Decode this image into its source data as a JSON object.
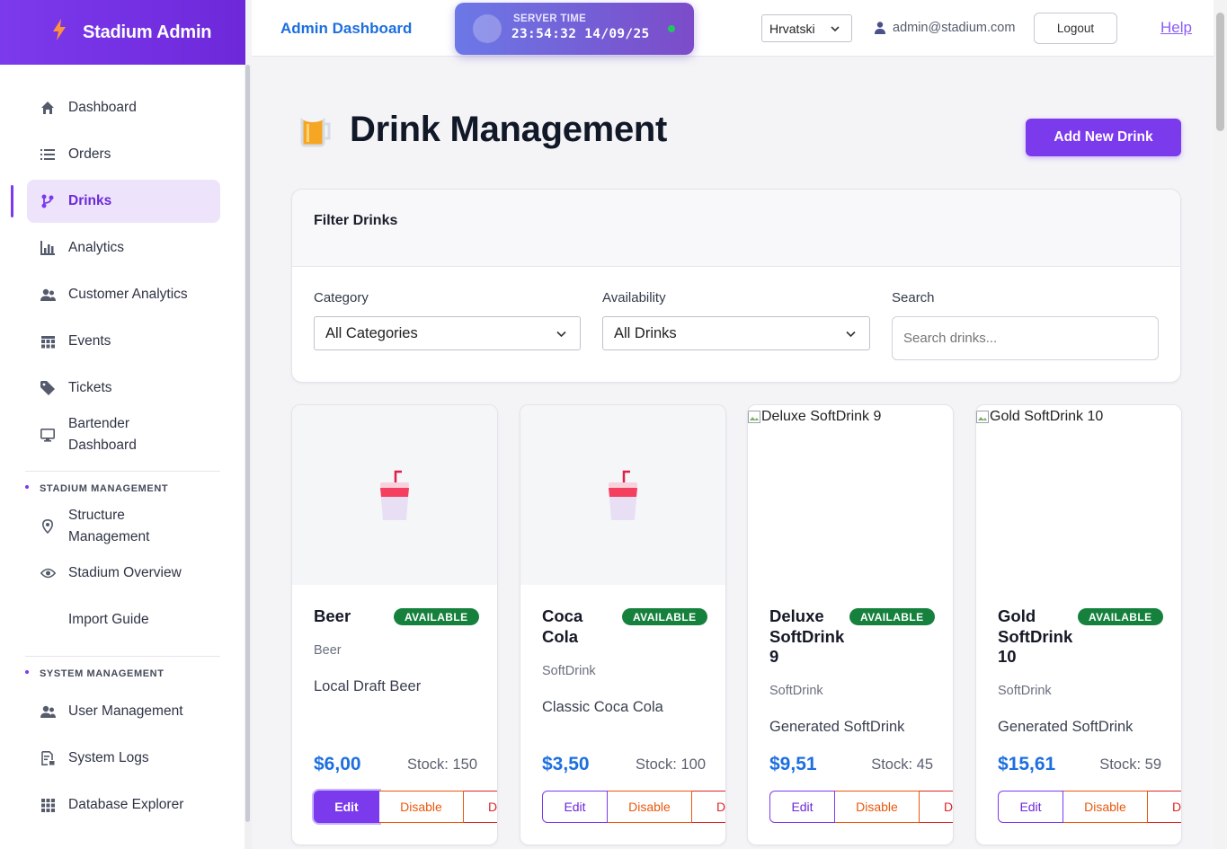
{
  "sidebar": {
    "brand": "Stadium Admin",
    "items": [
      {
        "label": "Dashboard",
        "icon": "home-icon"
      },
      {
        "label": "Orders",
        "icon": "list-icon"
      },
      {
        "label": "Drinks",
        "icon": "drinks-icon",
        "active": true
      },
      {
        "label": "Analytics",
        "icon": "bar-chart-icon"
      },
      {
        "label": "Customer Analytics",
        "icon": "users-icon"
      },
      {
        "label": "Events",
        "icon": "calendar-icon"
      },
      {
        "label": "Tickets",
        "icon": "tag-icon"
      },
      {
        "label": "Bartender Dashboard",
        "icon": "monitor-icon"
      }
    ],
    "stadium_section": "STADIUM MANAGEMENT",
    "stadium_items": [
      {
        "label": "Structure Management",
        "icon": "map-pin-icon"
      },
      {
        "label": "Stadium Overview",
        "icon": "eye-icon"
      },
      {
        "label": "Import Guide",
        "icon": ""
      }
    ],
    "system_section": "SYSTEM MANAGEMENT",
    "system_items": [
      {
        "label": "User Management",
        "icon": "users-icon"
      },
      {
        "label": "System Logs",
        "icon": "logs-icon"
      },
      {
        "label": "Database Explorer",
        "icon": "grid-icon"
      }
    ]
  },
  "header": {
    "title": "Admin Dashboard",
    "server_time_label": "SERVER TIME",
    "server_time_value": "23:54:32 14/09/25",
    "language": "Hrvatski",
    "user_email": "admin@stadium.com",
    "logout": "Logout",
    "help": "Help"
  },
  "page": {
    "title": "Drink Management",
    "add_button": "Add New Drink"
  },
  "filters": {
    "title": "Filter Drinks",
    "category_label": "Category",
    "category_value": "All Categories",
    "availability_label": "Availability",
    "availability_value": "All Drinks",
    "search_label": "Search",
    "search_placeholder": "Search drinks..."
  },
  "drinks": [
    {
      "name": "Beer",
      "status": "AVAILABLE",
      "category": "Beer",
      "description": "Local Draft Beer",
      "price": "$6,00",
      "stock": "Stock: 150",
      "image_alt": ""
    },
    {
      "name": "Coca Cola",
      "status": "AVAILABLE",
      "category": "SoftDrink",
      "description": "Classic Coca Cola",
      "price": "$3,50",
      "stock": "Stock: 100",
      "image_alt": ""
    },
    {
      "name": "Deluxe SoftDrink 9",
      "status": "AVAILABLE",
      "category": "SoftDrink",
      "description": "Generated SoftDrink",
      "price": "$9,51",
      "stock": "Stock: 45",
      "image_alt": "Deluxe SoftDrink 9"
    },
    {
      "name": "Gold SoftDrink 10",
      "status": "AVAILABLE",
      "category": "SoftDrink",
      "description": "Generated SoftDrink",
      "price": "$15,61",
      "stock": "Stock: 59",
      "image_alt": "Gold SoftDrink 10"
    }
  ],
  "actions": {
    "edit": "Edit",
    "disable": "Disable",
    "delete": "D"
  },
  "colors": {
    "accent": "#7c3aed",
    "price": "#1d6fe0",
    "available": "#16803d",
    "disable": "#ea580c",
    "delete": "#dc2626"
  }
}
